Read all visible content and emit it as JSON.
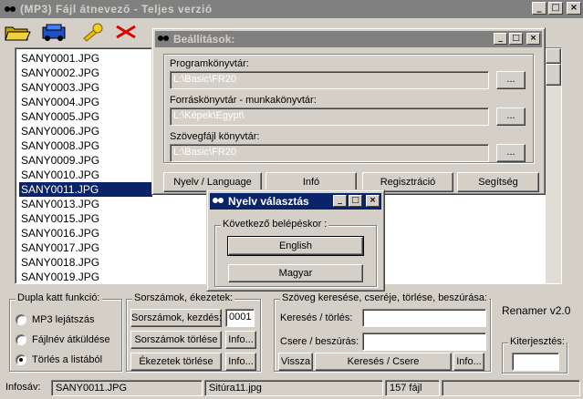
{
  "window": {
    "title": "(MP3)  Fájl átnevező  -  Teljes verzió",
    "buttons": [
      "_",
      "□",
      "×"
    ]
  },
  "files": [
    "SANY0001.JPG",
    "SANY0002.JPG",
    "SANY0003.JPG",
    "SANY0004.JPG",
    "SANY0005.JPG",
    "SANY0006.JPG",
    "SANY0008.JPG",
    "SANY0009.JPG",
    "SANY0010.JPG",
    "SANY0011.JPG",
    "SANY0013.JPG",
    "SANY0015.JPG",
    "SANY0016.JPG",
    "SANY0017.JPG",
    "SANY0018.JPG",
    "SANY0019.JPG"
  ],
  "selected_file": "SANY0011.JPG",
  "dblclick": {
    "label": "Dupla katt funkció:",
    "options": [
      "MP3 lejátszás",
      "Fájlnév átküldése",
      "Törlés a listából"
    ],
    "selected": 2
  },
  "numbering": {
    "label": "Sorszámok, ékezetek:",
    "start_button": "Sorszámok, kezdés:",
    "start_value": "0001",
    "delete_button": "Sorszámok törlése",
    "accents_button": "Ékezetek törlése",
    "info": "Info..."
  },
  "search": {
    "label": "Szöveg keresése, cseréje, törlése, beszúrása:",
    "find_label": "Keresés / törlés:",
    "replace_label": "Csere / beszúrás:",
    "back_button": "Vissza",
    "go_button": "Keresés / Csere",
    "info": "Info...",
    "find_value": "",
    "replace_value": ""
  },
  "version": "Renamer v2.0",
  "extension": {
    "label": "Kiterjesztés:",
    "value": ""
  },
  "status": {
    "label": "Infosáv:",
    "file": "SANY0011.JPG",
    "target": "Sitúra11.jpg",
    "count": "157 fájl"
  },
  "settings": {
    "title": "Beállítások:",
    "program_label": "Programkönyvtár:",
    "program_value": "L:\\Basic\\FR20",
    "source_label": "Forráskönyvtár - munkakönyvtár:",
    "source_value": "L:\\Képek\\Egypt\\",
    "text_label": "Szövegfájl könyvtár:",
    "text_value": "L:\\Basic\\FR20",
    "browse": "...",
    "tabs": [
      "Nyelv / Language",
      "Infó",
      "Regisztráció",
      "Segítség"
    ]
  },
  "language": {
    "title": "Nyelv választás",
    "group_label": "Következő belépéskor :",
    "english": "English",
    "hungarian": "Magyar"
  },
  "colors": {
    "selection": "#0a246a",
    "inactive_title": "#808080",
    "face": "#d4d0c8"
  }
}
